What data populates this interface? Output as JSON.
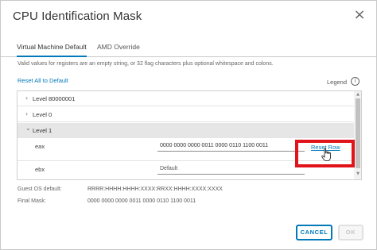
{
  "dialog": {
    "title": "CPU Identification Mask",
    "close_glyph": "×"
  },
  "tabs": [
    {
      "label": "Virtual Machine Default",
      "active": true
    },
    {
      "label": "AMD Override",
      "active": false
    }
  ],
  "info_text": "Valid values for registers are an empty string, or 32 flag characters plus optional whitespace and colons.",
  "reset_all_label": "Reset All to Default",
  "legend": {
    "label": "Legend",
    "icon": "info-icon",
    "glyph": "i"
  },
  "tree": {
    "levels": [
      {
        "label": "Level 80000001",
        "chevron": "›",
        "expanded": false
      },
      {
        "label": "Level 0",
        "chevron": "›",
        "expanded": false
      },
      {
        "label": "Level 1",
        "chevron": "⌄",
        "expanded": true
      }
    ],
    "registers": [
      {
        "name": "eax",
        "value": "0000 0000 0000 0011 0000 0110 1100 0011",
        "reset_label": "Reset Row"
      },
      {
        "name": "ebx",
        "value": "Default"
      }
    ]
  },
  "scrollbar": {
    "up_glyph": "▲",
    "down_glyph": "▼"
  },
  "guest_os_default": {
    "label": "Guest OS default:",
    "value": "RRRR:HHHH:HHHH:XXXX:RRXX:HHHH:XXXX:XXXX"
  },
  "final_mask": {
    "label": "Final Mask:",
    "value": "0000 0000 0000 0011 0000 0110 1100 0011"
  },
  "buttons": {
    "cancel": "CANCEL",
    "ok": "OK"
  },
  "colors": {
    "accent": "#0079b8",
    "highlight": "#e0131a",
    "selected_row": "#e6e6e6"
  }
}
